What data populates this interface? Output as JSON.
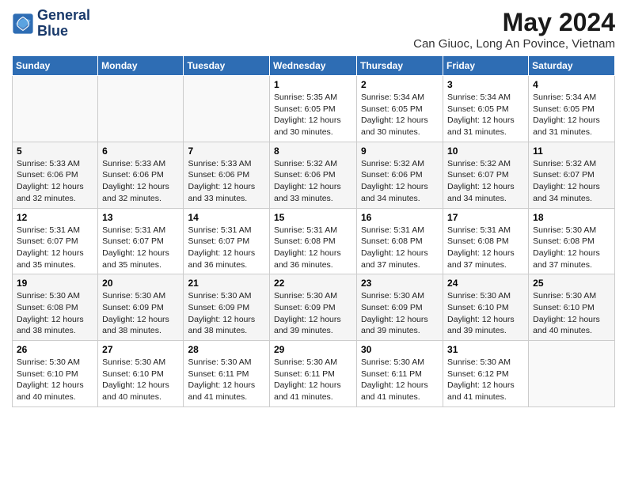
{
  "header": {
    "logo_line1": "General",
    "logo_line2": "Blue",
    "month_year": "May 2024",
    "location": "Can Giuoc, Long An Povince, Vietnam"
  },
  "weekdays": [
    "Sunday",
    "Monday",
    "Tuesday",
    "Wednesday",
    "Thursday",
    "Friday",
    "Saturday"
  ],
  "weeks": [
    [
      {
        "day": "",
        "info": ""
      },
      {
        "day": "",
        "info": ""
      },
      {
        "day": "",
        "info": ""
      },
      {
        "day": "1",
        "info": "Sunrise: 5:35 AM\nSunset: 6:05 PM\nDaylight: 12 hours\nand 30 minutes."
      },
      {
        "day": "2",
        "info": "Sunrise: 5:34 AM\nSunset: 6:05 PM\nDaylight: 12 hours\nand 30 minutes."
      },
      {
        "day": "3",
        "info": "Sunrise: 5:34 AM\nSunset: 6:05 PM\nDaylight: 12 hours\nand 31 minutes."
      },
      {
        "day": "4",
        "info": "Sunrise: 5:34 AM\nSunset: 6:05 PM\nDaylight: 12 hours\nand 31 minutes."
      }
    ],
    [
      {
        "day": "5",
        "info": "Sunrise: 5:33 AM\nSunset: 6:06 PM\nDaylight: 12 hours\nand 32 minutes."
      },
      {
        "day": "6",
        "info": "Sunrise: 5:33 AM\nSunset: 6:06 PM\nDaylight: 12 hours\nand 32 minutes."
      },
      {
        "day": "7",
        "info": "Sunrise: 5:33 AM\nSunset: 6:06 PM\nDaylight: 12 hours\nand 33 minutes."
      },
      {
        "day": "8",
        "info": "Sunrise: 5:32 AM\nSunset: 6:06 PM\nDaylight: 12 hours\nand 33 minutes."
      },
      {
        "day": "9",
        "info": "Sunrise: 5:32 AM\nSunset: 6:06 PM\nDaylight: 12 hours\nand 34 minutes."
      },
      {
        "day": "10",
        "info": "Sunrise: 5:32 AM\nSunset: 6:07 PM\nDaylight: 12 hours\nand 34 minutes."
      },
      {
        "day": "11",
        "info": "Sunrise: 5:32 AM\nSunset: 6:07 PM\nDaylight: 12 hours\nand 34 minutes."
      }
    ],
    [
      {
        "day": "12",
        "info": "Sunrise: 5:31 AM\nSunset: 6:07 PM\nDaylight: 12 hours\nand 35 minutes."
      },
      {
        "day": "13",
        "info": "Sunrise: 5:31 AM\nSunset: 6:07 PM\nDaylight: 12 hours\nand 35 minutes."
      },
      {
        "day": "14",
        "info": "Sunrise: 5:31 AM\nSunset: 6:07 PM\nDaylight: 12 hours\nand 36 minutes."
      },
      {
        "day": "15",
        "info": "Sunrise: 5:31 AM\nSunset: 6:08 PM\nDaylight: 12 hours\nand 36 minutes."
      },
      {
        "day": "16",
        "info": "Sunrise: 5:31 AM\nSunset: 6:08 PM\nDaylight: 12 hours\nand 37 minutes."
      },
      {
        "day": "17",
        "info": "Sunrise: 5:31 AM\nSunset: 6:08 PM\nDaylight: 12 hours\nand 37 minutes."
      },
      {
        "day": "18",
        "info": "Sunrise: 5:30 AM\nSunset: 6:08 PM\nDaylight: 12 hours\nand 37 minutes."
      }
    ],
    [
      {
        "day": "19",
        "info": "Sunrise: 5:30 AM\nSunset: 6:08 PM\nDaylight: 12 hours\nand 38 minutes."
      },
      {
        "day": "20",
        "info": "Sunrise: 5:30 AM\nSunset: 6:09 PM\nDaylight: 12 hours\nand 38 minutes."
      },
      {
        "day": "21",
        "info": "Sunrise: 5:30 AM\nSunset: 6:09 PM\nDaylight: 12 hours\nand 38 minutes."
      },
      {
        "day": "22",
        "info": "Sunrise: 5:30 AM\nSunset: 6:09 PM\nDaylight: 12 hours\nand 39 minutes."
      },
      {
        "day": "23",
        "info": "Sunrise: 5:30 AM\nSunset: 6:09 PM\nDaylight: 12 hours\nand 39 minutes."
      },
      {
        "day": "24",
        "info": "Sunrise: 5:30 AM\nSunset: 6:10 PM\nDaylight: 12 hours\nand 39 minutes."
      },
      {
        "day": "25",
        "info": "Sunrise: 5:30 AM\nSunset: 6:10 PM\nDaylight: 12 hours\nand 40 minutes."
      }
    ],
    [
      {
        "day": "26",
        "info": "Sunrise: 5:30 AM\nSunset: 6:10 PM\nDaylight: 12 hours\nand 40 minutes."
      },
      {
        "day": "27",
        "info": "Sunrise: 5:30 AM\nSunset: 6:10 PM\nDaylight: 12 hours\nand 40 minutes."
      },
      {
        "day": "28",
        "info": "Sunrise: 5:30 AM\nSunset: 6:11 PM\nDaylight: 12 hours\nand 41 minutes."
      },
      {
        "day": "29",
        "info": "Sunrise: 5:30 AM\nSunset: 6:11 PM\nDaylight: 12 hours\nand 41 minutes."
      },
      {
        "day": "30",
        "info": "Sunrise: 5:30 AM\nSunset: 6:11 PM\nDaylight: 12 hours\nand 41 minutes."
      },
      {
        "day": "31",
        "info": "Sunrise: 5:30 AM\nSunset: 6:12 PM\nDaylight: 12 hours\nand 41 minutes."
      },
      {
        "day": "",
        "info": ""
      }
    ]
  ]
}
